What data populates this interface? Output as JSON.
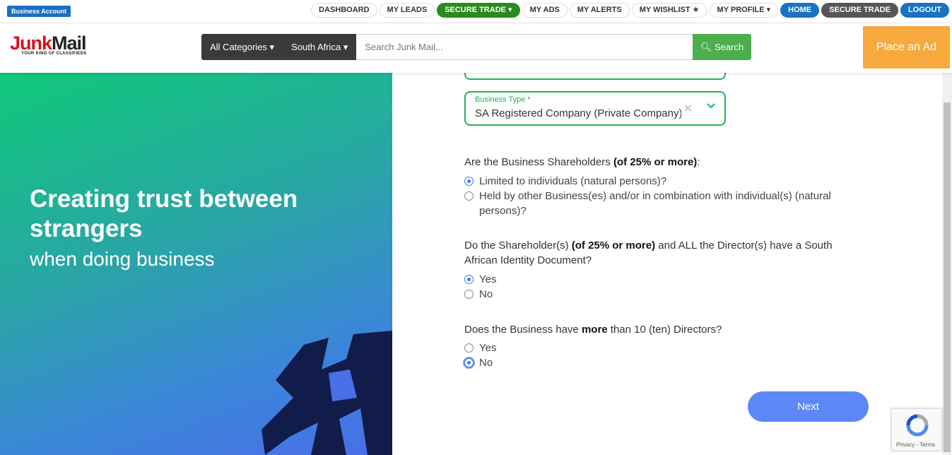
{
  "topnav": {
    "badge": "Business Account",
    "links": [
      {
        "label": "DASHBOARD"
      },
      {
        "label": "MY LEADS"
      },
      {
        "label": "SECURE TRADE ▾"
      },
      {
        "label": "MY ADS"
      },
      {
        "label": "MY ALERTS"
      },
      {
        "label": "MY WISHLIST ★"
      },
      {
        "label": "MY PROFILE ▾"
      },
      {
        "label": "HOME"
      },
      {
        "label": "SECURE TRADE"
      },
      {
        "label": "LOGOUT"
      }
    ]
  },
  "header": {
    "logo_junk": "Junk",
    "logo_mail": "Mail",
    "logo_tag": "YOUR KING OF CLASSIFIEDS",
    "categories": "All Categories ▾",
    "region": "South Africa ▾",
    "search_placeholder": "Search Junk Mail...",
    "search_button": "Search",
    "place_ad": "Place an Ad"
  },
  "hero": {
    "title": "Creating trust between strangers",
    "subtitle": "when doing business"
  },
  "form": {
    "business_type_label": "Business Type *",
    "business_type_value": "SA Registered Company (Private Company)",
    "q1": {
      "text_a": "Are the Business Shareholders ",
      "text_bold": "(of 25% or more)",
      "text_b": ":",
      "options": [
        {
          "label": "Limited to individuals (natural persons)?",
          "checked": true
        },
        {
          "label": "Held by other Business(es) and/or in combination with individual(s) (natural persons)?",
          "checked": false
        }
      ]
    },
    "q2": {
      "text_a": "Do the Shareholder(s) ",
      "text_bold": "(of 25% or more)",
      "text_b": " and ALL the Director(s) have a South African Identity Document?",
      "options": [
        {
          "label": "Yes",
          "checked": true
        },
        {
          "label": "No",
          "checked": false
        }
      ]
    },
    "q3": {
      "text_a": "Does the Business have ",
      "text_bold": "more",
      "text_b": " than 10 (ten) Directors?",
      "options": [
        {
          "label": "Yes",
          "checked": false
        },
        {
          "label": "No",
          "checked": true
        }
      ]
    },
    "next": "Next"
  },
  "recaptcha": {
    "terms": "Privacy - Terms"
  },
  "colors": {
    "accent_green": "#21b35a",
    "radio_blue": "#3c7bf2",
    "next_button": "#5b87f7",
    "place_ad": "#f7a93e"
  }
}
